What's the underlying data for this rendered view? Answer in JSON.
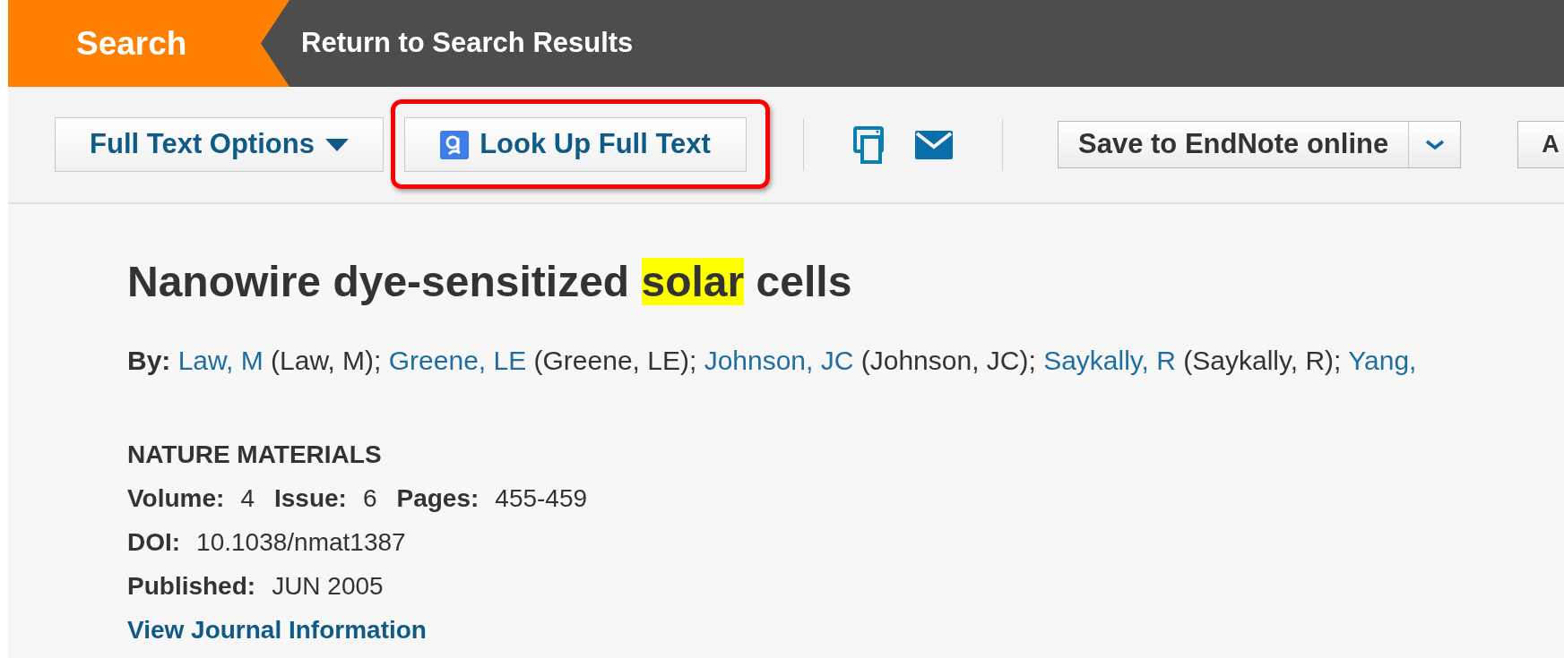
{
  "nav": {
    "home": "Search",
    "back_link": "Return to Search Results"
  },
  "toolbar": {
    "full_text_options": "Full Text Options",
    "look_up": {
      "label": "Look Up Full Text",
      "highlighted": true
    },
    "save": "Save to EndNote online",
    "next_button": "A"
  },
  "record": {
    "title": [
      {
        "text": "Nanowire dye-sensitized ",
        "highlighted": false
      },
      {
        "text": "solar",
        "highlighted": true
      },
      {
        "text": " cells",
        "highlighted": false
      }
    ],
    "authors_label": "By:",
    "authors": [
      {
        "name": "Law, M",
        "full": "(Law, M);"
      },
      {
        "name": "Greene, LE",
        "full": "(Greene, LE);"
      },
      {
        "name": "Johnson, JC",
        "full": "(Johnson, JC);"
      },
      {
        "name": "Saykally, R",
        "full": "(Saykally, R);"
      },
      {
        "name": "Yang,"
      }
    ],
    "journal": "NATURE MATERIALS",
    "issue_fields": [
      {
        "label": "Volume:",
        "value": "4"
      },
      {
        "label": "Issue:",
        "value": "6"
      },
      {
        "label": "Pages:",
        "value": "455-459"
      }
    ],
    "fields": [
      {
        "label": "DOI:",
        "value": "10.1038/nmat1387"
      },
      {
        "label": "Published:",
        "value": "JUN 2005"
      }
    ],
    "journal_link": "View Journal Information"
  }
}
